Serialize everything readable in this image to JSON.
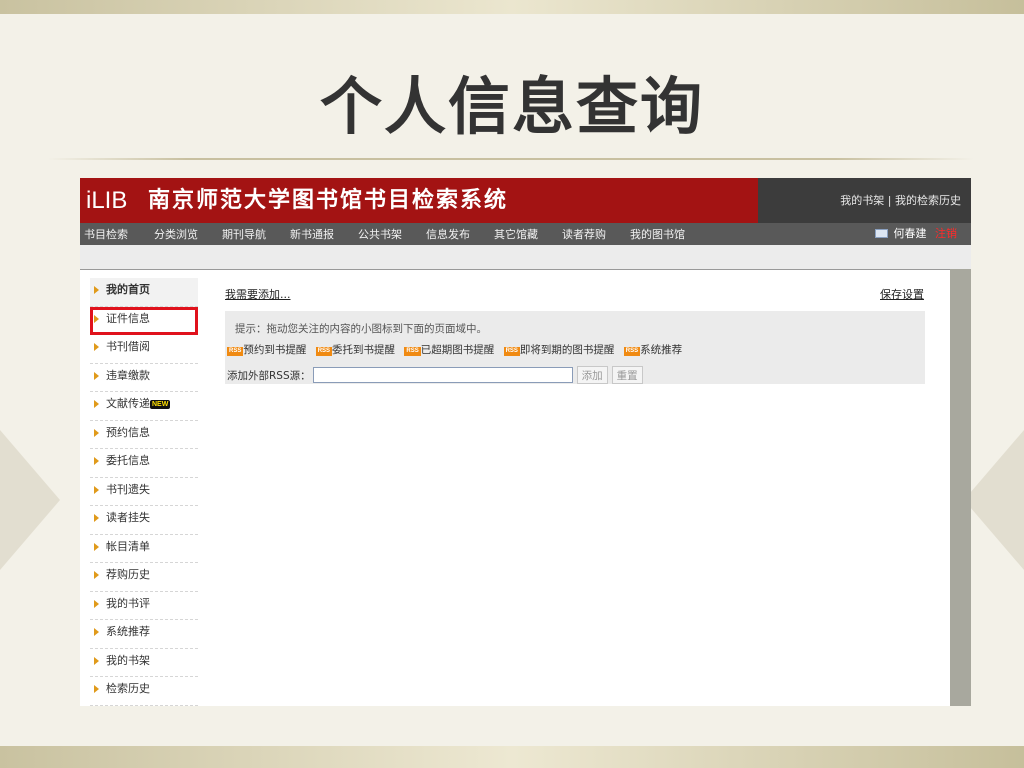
{
  "slide": {
    "title": "个人信息查询"
  },
  "header": {
    "logo": "iLIB",
    "system_title": "南京师范大学图书馆书目检索系统",
    "links": [
      "我的书架",
      "我的检索历史"
    ],
    "separator": " | "
  },
  "nav": {
    "items": [
      "书目检索",
      "分类浏览",
      "期刊导航",
      "新书通报",
      "公共书架",
      "信息发布",
      "其它馆藏",
      "读者荐购",
      "我的图书馆"
    ],
    "user": "何春建",
    "logout": "注销"
  },
  "sidebar": {
    "items": [
      "我的首页",
      "证件信息",
      "书刊借阅",
      "违章缴款",
      "文献传递",
      "预约信息",
      "委托信息",
      "书刊遗失",
      "读者挂失",
      "帐目清单",
      "荐购历史",
      "我的书评",
      "系统推荐",
      "我的书架",
      "检索历史"
    ],
    "new_badge": "NEW",
    "active_item": "证件信息",
    "highlight_color": "#e0121c"
  },
  "main": {
    "add_link": "我需要添加...",
    "save_link": "保存设置",
    "hint": "提示：拖动您关注的内容的小图标到下面的页面域中。",
    "rss_badge": "RSS",
    "feeds": [
      "预约到书提醒",
      "委托到书提醒",
      "已超期图书提醒",
      "即将到期的图书提醒",
      "系统推荐"
    ],
    "rss_label": "添加外部RSS源：",
    "rss_input_value": "",
    "add_button": "添加",
    "reset_button": "重置"
  },
  "colors": {
    "header_red": "#a31313",
    "nav_gray": "#595959",
    "accent_orange": "#e09a1a"
  }
}
